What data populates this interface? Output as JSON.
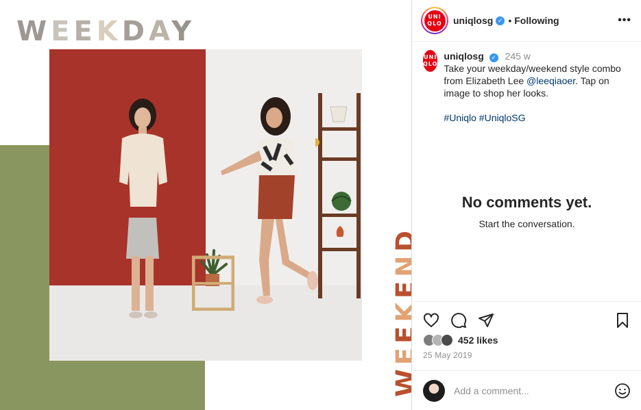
{
  "media": {
    "headline_letters": [
      "W",
      "E",
      "E",
      "K",
      "D",
      "A",
      "Y"
    ],
    "vertical_letters": [
      "W",
      "E",
      "E",
      "K",
      "E",
      "N",
      "D"
    ],
    "colors": {
      "green_block": "#8a9660",
      "red_wall": "#a8332a",
      "white_wall": "#efeeec"
    }
  },
  "header": {
    "username": "uniqlosg",
    "logo_top": "UNI",
    "logo_bottom": "QLO",
    "dot": "•",
    "follow_status": "Following",
    "more_label": "•••"
  },
  "caption": {
    "username": "uniqlosg",
    "time_ago": "245 w",
    "text_before_mention": "Take your weekday/weekend style combo from Elizabeth Lee ",
    "mention": "@leeqiaoer",
    "text_after_mention": ". Tap on image to shop her looks.",
    "hashtags": [
      "#Uniqlo",
      "#UniqloSG"
    ]
  },
  "comments": {
    "empty_title": "No comments yet.",
    "empty_subtitle": "Start the conversation."
  },
  "actions": {
    "likes_label": "452 likes",
    "date": "25 May 2019"
  },
  "comment_box": {
    "placeholder": "Add a comment..."
  },
  "icons": [
    "heart-icon",
    "comment-icon",
    "share-icon",
    "bookmark-icon",
    "emoji-icon",
    "verified-badge-icon",
    "more-options-icon"
  ]
}
